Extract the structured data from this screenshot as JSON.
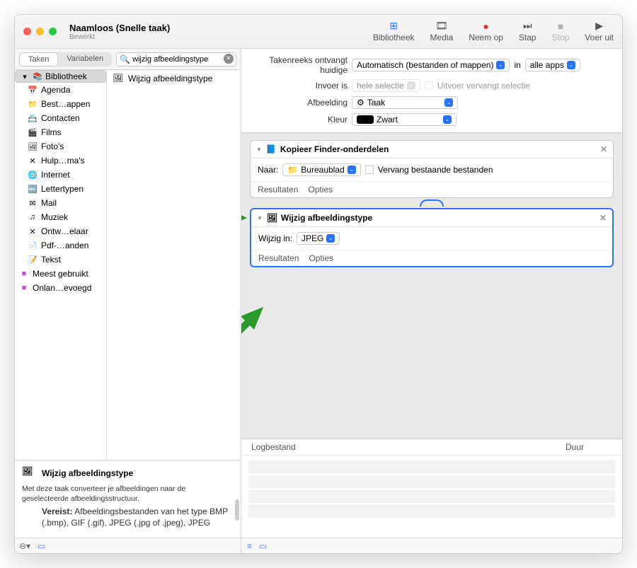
{
  "window": {
    "title": "Naamloos (Snelle taak)",
    "subtitle": "Bewerkt"
  },
  "toolbar": [
    {
      "icon": "⊞",
      "label": "Bibliotheek"
    },
    {
      "icon": "🎞",
      "label": "Media"
    },
    {
      "icon": "●",
      "label": "Neem op"
    },
    {
      "icon": "⏭",
      "label": "Stap"
    },
    {
      "icon": "■",
      "label": "Stop"
    },
    {
      "icon": "▶",
      "label": "Voer uit"
    }
  ],
  "tabs": {
    "active": "Taken",
    "other": "Variabelen"
  },
  "search": {
    "placeholder": "",
    "value": "wijzig afbeeldingstype"
  },
  "library": {
    "root": "Bibliotheek",
    "items": [
      {
        "icon": "📅",
        "label": "Agenda",
        "color": "#d94b4b"
      },
      {
        "icon": "📁",
        "label": "Best…appen",
        "color": "#3a79d8"
      },
      {
        "icon": "📇",
        "label": "Contacten",
        "color": "#a06a3e"
      },
      {
        "icon": "🎬",
        "label": "Films",
        "color": "#2e8fbf"
      },
      {
        "icon": "🖼",
        "label": "Foto's",
        "color": "#5c5c5c"
      },
      {
        "icon": "✕",
        "label": "Hulp…ma's",
        "color": "#777"
      },
      {
        "icon": "🌐",
        "label": "Internet",
        "color": "#2b73ff"
      },
      {
        "icon": "🔤",
        "label": "Lettertypen",
        "color": "#555"
      },
      {
        "icon": "✉",
        "label": "Mail",
        "color": "#3a9de0"
      },
      {
        "icon": "♫",
        "label": "Muziek",
        "color": "#e24b63"
      },
      {
        "icon": "✕",
        "label": "Ontw…elaar",
        "color": "#777"
      },
      {
        "icon": "📄",
        "label": "Pdf-…anden",
        "color": "#999"
      },
      {
        "icon": "📝",
        "label": "Tekst",
        "color": "#555"
      }
    ],
    "extra": [
      {
        "icon": "■",
        "label": "Meest gebruikt",
        "color": "#c64bd8"
      },
      {
        "icon": "■",
        "label": "Onlan…evoegd",
        "color": "#c64bd8"
      }
    ]
  },
  "results": [
    {
      "label": "Wijzig afbeeldingstype"
    }
  ],
  "description": {
    "title": "Wijzig afbeeldingstype",
    "body": "Met deze taak converteer je afbeeldingen naar de geselecteerde afbeeldingsstructuur.",
    "req_label": "Vereist:",
    "req_body": "Afbeeldingsbestanden van het type BMP (.bmp), GIF (.gif), JPEG (.jpg of .jpeg), JPEG"
  },
  "config": {
    "row1_label": "Takenreeks ontvangt huidige",
    "row1_val": "Automatisch (bestanden of mappen)",
    "row1_in": "in",
    "row1_app": "alle apps",
    "row2_label": "Invoer is",
    "row2_val": "hele selectie",
    "row2_chk": "Uitvoer vervangt selectie",
    "row3_label": "Afbeelding",
    "row3_val": "Taak",
    "row4_label": "Kleur",
    "row4_val": "Zwart"
  },
  "actions": [
    {
      "title": "Kopieer Finder-onderdelen",
      "field_label": "Naar:",
      "field_val": "Bureaublad",
      "chk_label": "Vervang bestaande bestanden",
      "res": "Resultaten",
      "opt": "Opties"
    },
    {
      "title": "Wijzig afbeeldingstype",
      "field_label": "Wijzig in:",
      "field_val": "JPEG",
      "res": "Resultaten",
      "opt": "Opties"
    }
  ],
  "log": {
    "col1": "Logbestand",
    "col2": "Duur"
  }
}
